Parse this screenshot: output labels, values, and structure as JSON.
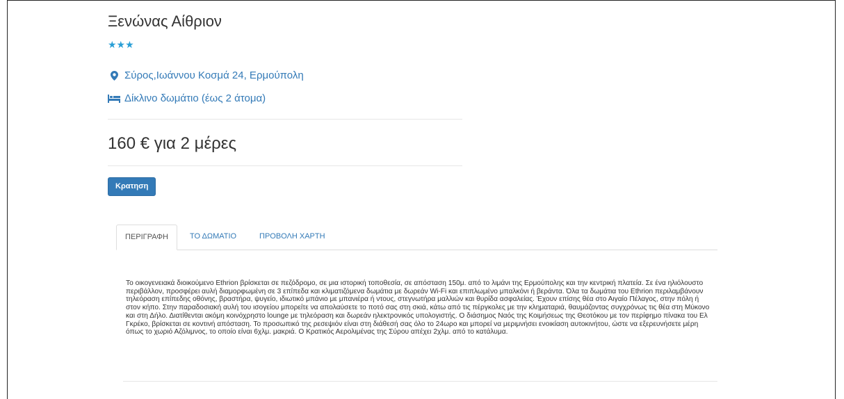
{
  "hotel": {
    "name": "Ξενώνας Αίθριον",
    "stars": "★★★",
    "location": "Σύρος,Ιωάννου Κοσμά 24, Ερμούπολη",
    "room_type": "Δίκλινο δωμάτιο (έως 2 άτομα)",
    "price": "160 € για 2 μέρες",
    "book_label": "Κρατηση"
  },
  "tabs": [
    {
      "label": "ΠΕΡΙΓΡΑΦΗ"
    },
    {
      "label": "ΤΟ ΔΩΜΑΤΙΟ"
    },
    {
      "label": "ΠΡΟΒΟΛΗ ΧΑΡΤΗ"
    }
  ],
  "description": "Το οικογενειακά διοικούμενο Ethrion βρίσκεται σε πεζόδρομο, σε μια ιστορική τοποθεσία, σε απόσταση 150μ. από το λιμάνι της Ερμούπολης και την κεντρική πλατεία. Σε ένα ηλιόλουστο περιβάλλον, προσφέρει αυλή διαμορφωμένη σε 3 επίπεδα και κλιματιζόμενα δωμάτια με δωρεάν Wi-Fi και επιπλωμένο μπαλκόνι ή βεράντα. Όλα τα δωμάτια του Ethrion περιλαμβάνουν τηλεόραση επίπεδης οθόνης, βραστήρα, ψυγείο, ιδιωτικό μπάνιο με μπανιέρα ή ντους, στεγνωτήρα μαλλιών και θυρίδα ασφαλείας. Έχουν επίσης θέα στο Αιγαίο Πέλαγος, στην πόλη ή στον κήπο. Στην παραδοσιακή αυλή του ισογείου μπορείτε να απολαύσετε το ποτό σας στη σκιά, κάτω από τις πέργκολες με την κληματαριά, θαυμάζοντας συγχρόνως τις θέα στη Μύκονο και στη Δήλο. Διατίθενται ακόμη κοινόχρηστο lounge με τηλεόραση και δωρεάν ηλεκτρονικός υπολογιστής. Ο διάσημος Ναός της Κοιμήσεως της Θεοτόκου με τον περίφημο πίνακα του Ελ Γκρέκο, βρίσκεται σε κοντινή απόσταση. Το προσωπικό της ρεσεψιόν είναι στη διάθεσή σας όλο το 24ωρο και μπορεί να μεριμνήσει ενοικίαση αυτοκινήτου, ώστε να εξερευνήσετε μέρη όπως το χωριό Αζόλιμνος, το οποίο είναι 6χλμ. μακριά. Ο Κρατικός Αερολιμένας της Σύρου απέχει 2χλμ. από το κατάλυμα.",
  "icons": {
    "location": "map-marker-icon",
    "room": "bed-icon"
  },
  "colors": {
    "link": "#337ab7",
    "stars": "#2a9fd6",
    "button": "#337ab7"
  }
}
